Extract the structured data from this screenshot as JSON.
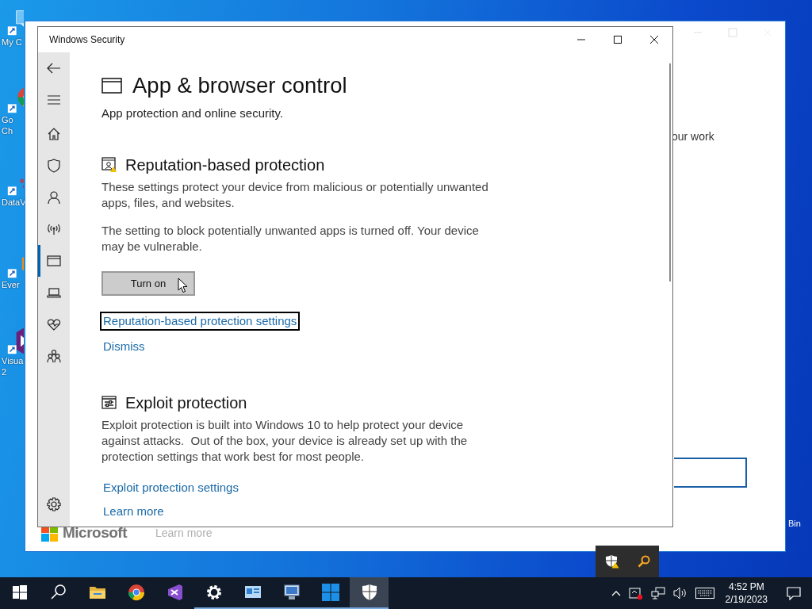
{
  "desktop": {
    "icons": [
      {
        "kind": "computer",
        "lines": [
          "My C"
        ]
      },
      {
        "kind": "chrome",
        "lines": [
          "Go",
          "Ch"
        ]
      },
      {
        "kind": "dataviz",
        "lines": [
          "DataV"
        ]
      },
      {
        "kind": "evernote",
        "lines": [
          "Ever"
        ]
      },
      {
        "kind": "studio",
        "lines": [
          "Visua",
          "2"
        ]
      }
    ],
    "recycle_label": "Bin"
  },
  "background_window": {
    "text": "our work",
    "brand": "Microsoft",
    "link": "Learn more"
  },
  "window": {
    "title": "Windows Security",
    "nav": [
      {
        "kind": "home",
        "selected": false
      },
      {
        "kind": "shield",
        "selected": false
      },
      {
        "kind": "person",
        "selected": false
      },
      {
        "kind": "wireless",
        "selected": false
      },
      {
        "kind": "browser",
        "selected": true
      },
      {
        "kind": "laptop",
        "selected": false
      },
      {
        "kind": "heart",
        "selected": false
      },
      {
        "kind": "family",
        "selected": false
      }
    ],
    "heading": "App & browser control",
    "subtitle": "App protection and online security.",
    "sections": [
      {
        "kind": "reputation",
        "heading": "Reputation-based protection",
        "paragraphs": [
          "These settings protect your device from malicious or potentially unwanted apps, files, and websites.",
          "The setting to block potentially unwanted apps is turned off. Your device may be vulnerable."
        ],
        "button": "Turn on",
        "links": [
          {
            "label": "Reputation-based protection settings",
            "focused": true
          },
          {
            "label": "Dismiss",
            "focused": false
          }
        ]
      },
      {
        "kind": "exploit",
        "heading": "Exploit protection",
        "paragraphs": [
          "Exploit protection is built into Windows 10 to help protect your device against attacks.  Out of the box, your device is already set up with the protection settings that work best for most people."
        ],
        "links": [
          {
            "label": "Exploit protection settings",
            "focused": false
          },
          {
            "label": "Learn more",
            "focused": false
          }
        ]
      }
    ]
  },
  "taskbar": {
    "apps": [
      {
        "kind": "start",
        "running": false,
        "selected": false
      },
      {
        "kind": "search",
        "running": false,
        "selected": false
      },
      {
        "kind": "folder",
        "running": false,
        "selected": false
      },
      {
        "kind": "chrome",
        "running": false,
        "selected": false
      },
      {
        "kind": "studio",
        "running": false,
        "selected": false
      },
      {
        "kind": "gear",
        "running": true,
        "selected": false
      },
      {
        "kind": "dashboard",
        "running": true,
        "selected": false
      },
      {
        "kind": "monitor",
        "running": true,
        "selected": false
      },
      {
        "kind": "tiles",
        "running": true,
        "selected": false
      },
      {
        "kind": "shield",
        "running": true,
        "selected": true
      }
    ],
    "time": "4:52 PM",
    "date": "2/19/2023"
  }
}
